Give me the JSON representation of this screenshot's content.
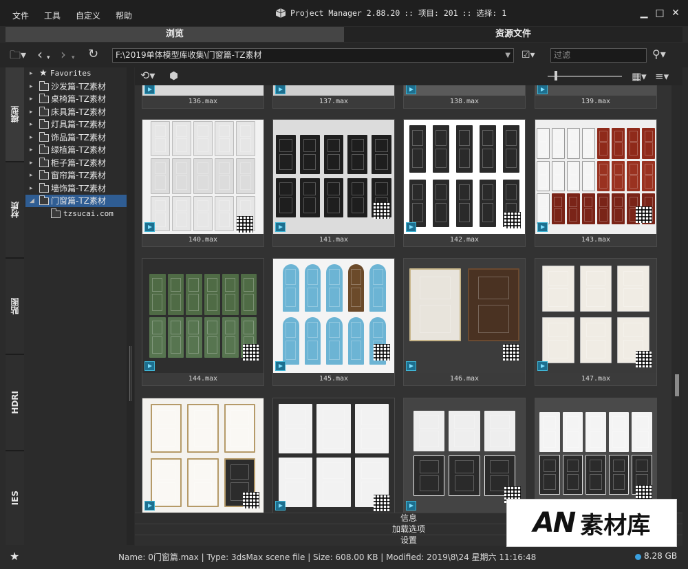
{
  "menu": {
    "file": "文件",
    "tools": "工具",
    "customize": "自定义",
    "help": "帮助"
  },
  "title": {
    "app": "Project Manager 2.88.20",
    "items": ":: 项目: 201",
    "selection": ":: 选择: 1"
  },
  "tabs": {
    "browse": "浏览",
    "assets": "资源文件"
  },
  "path": {
    "value": "F:\\2019单体模型库收集\\门窗篇-TZ素材",
    "filter_placeholder": "过滤"
  },
  "vtabs": [
    "模型",
    "材质",
    "贴图",
    "HDRI",
    "IES"
  ],
  "tree": {
    "favorites": "Favorites",
    "items": [
      "沙发篇-TZ素材",
      "桌椅篇-TZ素材",
      "床具篇-TZ素材",
      "灯具篇-TZ素材",
      "饰品篇-TZ素材",
      "绿植篇-TZ素材",
      "柜子篇-TZ素材",
      "窗帘篇-TZ素材",
      "墙饰篇-TZ素材",
      "门窗篇-TZ素材"
    ],
    "subitem": "tzsucai.com"
  },
  "grid": {
    "row1": [
      "136.max",
      "137.max",
      "138.max",
      "139.max"
    ],
    "row2": [
      "140.max",
      "141.max",
      "142.max",
      "143.max"
    ],
    "row3": [
      "144.max",
      "145.max",
      "146.max",
      "147.max"
    ]
  },
  "panels": {
    "info": "信息",
    "load_options": "加载选项",
    "settings": "设置"
  },
  "status": {
    "text": "Name: 0门窗篇.max | Type: 3dsMax scene file | Size: 608.00 KB | Modified: 2019\\8\\24 星期六 11:16:48",
    "disk": "8.28 GB"
  },
  "watermark": {
    "logo": "AN",
    "text": "素材库"
  },
  "colors": {
    "selected": "#2f5d93",
    "accent": "#3aa0e0"
  }
}
